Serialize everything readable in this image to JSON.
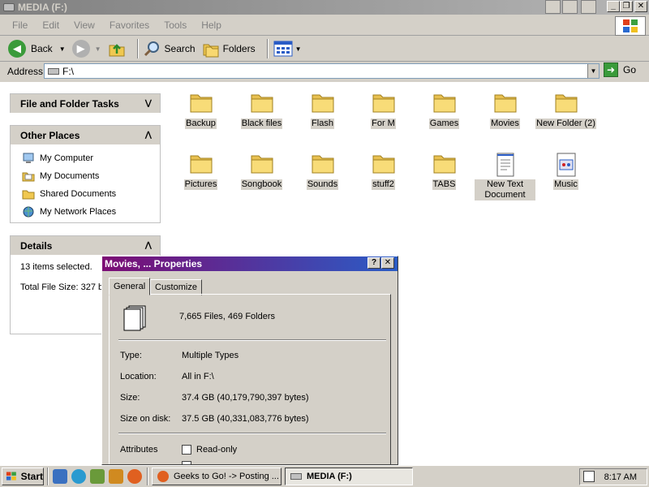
{
  "window": {
    "title": "MEDIA (F:)"
  },
  "menu": [
    "File",
    "Edit",
    "View",
    "Favorites",
    "Tools",
    "Help"
  ],
  "toolbar": {
    "back": "Back",
    "search": "Search",
    "folders": "Folders"
  },
  "address": {
    "label": "Address",
    "value": "F:\\",
    "go": "Go"
  },
  "tasks": {
    "file_folder_title": "File and Folder Tasks",
    "other_places_title": "Other Places",
    "other_places": [
      "My Computer",
      "My Documents",
      "Shared Documents",
      "My Network Places"
    ],
    "details_title": "Details",
    "details_items": "13 items selected.",
    "details_size": "Total File Size: 327 b"
  },
  "items": [
    {
      "name": "Backup",
      "type": "folder"
    },
    {
      "name": "Black files",
      "type": "folder"
    },
    {
      "name": "Flash",
      "type": "folder"
    },
    {
      "name": "For M",
      "type": "folder"
    },
    {
      "name": "Games",
      "type": "folder"
    },
    {
      "name": "Movies",
      "type": "folder"
    },
    {
      "name": "New Folder (2)",
      "type": "folder"
    },
    {
      "name": "Pictures",
      "type": "folder"
    },
    {
      "name": "Songbook",
      "type": "folder"
    },
    {
      "name": "Sounds",
      "type": "folder"
    },
    {
      "name": "stuff2",
      "type": "folder"
    },
    {
      "name": "TABS",
      "type": "folder"
    },
    {
      "name": "New Text Document",
      "type": "text-file"
    },
    {
      "name": "Music",
      "type": "media-file"
    }
  ],
  "dialog": {
    "title": "Movies, ... Properties",
    "tab_general": "General",
    "tab_customize": "Customize",
    "summary": "7,665 Files, 469 Folders",
    "type_label": "Type:",
    "type_value": "Multiple Types",
    "location_label": "Location:",
    "location_value": "All in F:\\",
    "size_label": "Size:",
    "size_value": "37.4 GB (40,179,790,397 bytes)",
    "size_on_disk_label": "Size on disk:",
    "size_on_disk_value": "37.5 GB (40,331,083,776 bytes)",
    "attributes_label": "Attributes",
    "readonly_label": "Read-only"
  },
  "taskbar": {
    "start": "Start",
    "tasks": [
      "Geeks to Go! -> Posting ...",
      "MEDIA (F:)"
    ],
    "clock": "8:17 AM"
  },
  "colors": {
    "dialog_title_start": "#7c0c74",
    "dialog_title_end": "#2a5cc6",
    "label_bg": "#d4d0c8"
  }
}
